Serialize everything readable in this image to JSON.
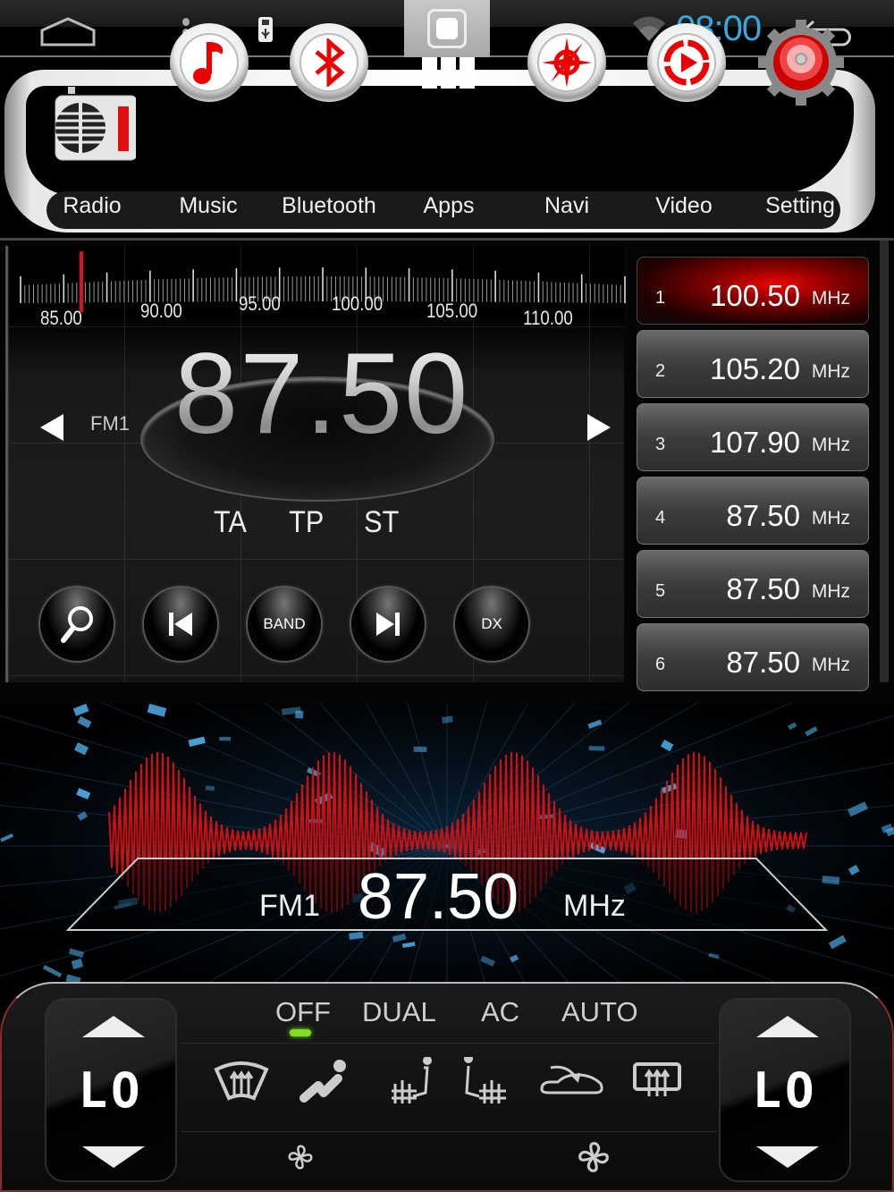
{
  "status_bar": {
    "time": "08:00",
    "icons": [
      "home-icon",
      "menu-icon",
      "usb-icon",
      "recent-apps-icon",
      "wifi-icon",
      "back-icon"
    ]
  },
  "launcher": {
    "apps": [
      {
        "label": "Radio",
        "icon": "radio-icon"
      },
      {
        "label": "Music",
        "icon": "music-note-icon"
      },
      {
        "label": "Bluetooth",
        "icon": "bluetooth-icon"
      },
      {
        "label": "Apps",
        "icon": "apps-grid-icon"
      },
      {
        "label": "Navi",
        "icon": "compass-icon"
      },
      {
        "label": "Video",
        "icon": "play-icon"
      },
      {
        "label": "Setting",
        "icon": "gear-icon"
      }
    ]
  },
  "radio": {
    "band": "FM1",
    "frequency": "87.50",
    "scale_labels": [
      "85.00",
      "90.00",
      "95.00",
      "100.00",
      "105.00",
      "110.00"
    ],
    "scale_range_mhz": [
      85.0,
      111.0
    ],
    "needle_mhz": 87.5,
    "flags": [
      "TA",
      "TP",
      "ST"
    ],
    "controls": [
      {
        "name": "search-button",
        "label": "",
        "icon": "search-icon"
      },
      {
        "name": "prev-button",
        "label": "",
        "icon": "skip-previous-icon"
      },
      {
        "name": "band-button",
        "label": "BAND"
      },
      {
        "name": "next-button",
        "label": "",
        "icon": "skip-next-icon"
      },
      {
        "name": "dx-button",
        "label": "DX"
      }
    ],
    "presets": [
      {
        "num": "1",
        "freq": "100.50",
        "unit": "MHz",
        "active": true
      },
      {
        "num": "2",
        "freq": "105.20",
        "unit": "MHz",
        "active": false
      },
      {
        "num": "3",
        "freq": "107.90",
        "unit": "MHz",
        "active": false
      },
      {
        "num": "4",
        "freq": "87.50",
        "unit": "MHz",
        "active": false
      },
      {
        "num": "5",
        "freq": "87.50",
        "unit": "MHz",
        "active": false
      },
      {
        "num": "6",
        "freq": "87.50",
        "unit": "MHz",
        "active": false
      }
    ]
  },
  "readout": {
    "band": "FM1",
    "frequency": "87.50",
    "unit": "MHz"
  },
  "climate": {
    "left_temp": "LO",
    "right_temp": "LO",
    "modes": [
      "OFF",
      "DUAL",
      "AC",
      "AUTO"
    ],
    "active_mode": "OFF",
    "led_color": "#7fe020",
    "icons": [
      "windshield-defrost-icon",
      "air-flow-icon",
      "seat-heat-left-icon",
      "seat-heat-right-icon",
      "recirculation-icon",
      "rear-defrost-icon"
    ]
  },
  "colors": {
    "accent_red": "#e21010",
    "clock_blue": "#3aa6dc"
  }
}
